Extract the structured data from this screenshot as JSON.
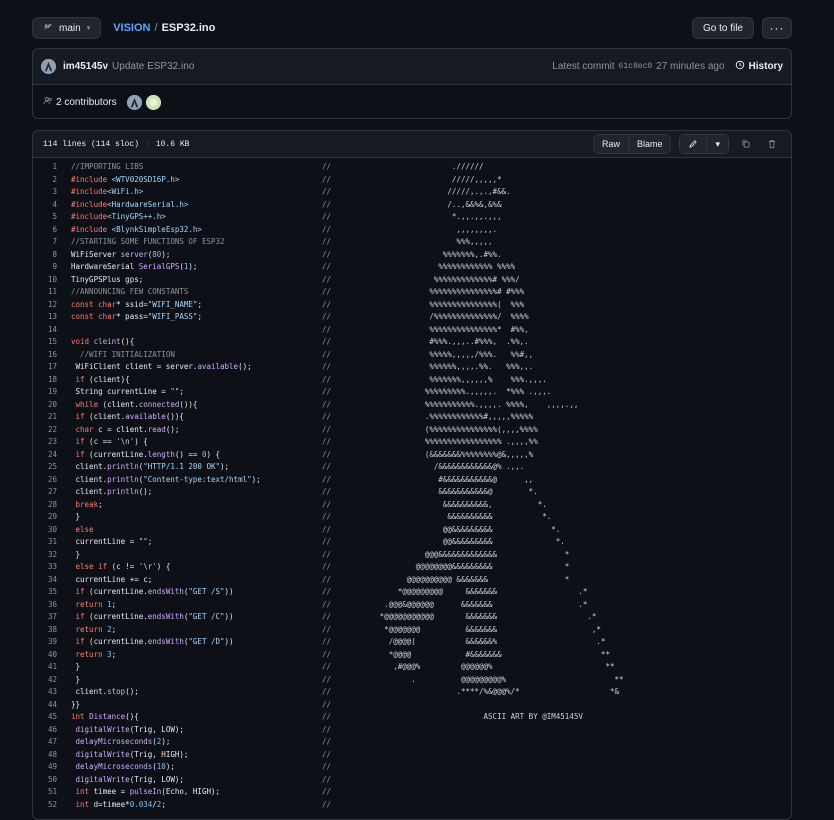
{
  "topbar": {
    "branch": "main",
    "repo": "VISION",
    "separator": "/",
    "file": "ESP32.ino",
    "goto_file": "Go to file",
    "more": "···"
  },
  "commit": {
    "author": "im45145v",
    "message": "Update ESP32.ino",
    "latest_label": "Latest commit",
    "hash": "61c8ec0",
    "time": "27 minutes ago",
    "history": "History",
    "contributors": "2 contributors"
  },
  "file_header": {
    "lines": "114 lines (114 sloc)",
    "size": "10.6 KB",
    "raw": "Raw",
    "blame": "Blame"
  },
  "code_lines": [
    {
      "n": "1",
      "code": "//IMPORTING LIBS",
      "art": "                           .//////"
    },
    {
      "n": "2",
      "code": "#include <WTV020SD16P.h>",
      "art": "                           /////,,,,,*"
    },
    {
      "n": "3",
      "code": "#include<WiFi.h>",
      "art": "                          /////,.,.,#&&."
    },
    {
      "n": "4",
      "code": "#include<HardwareSerial.h>",
      "art": "                          /..,&&%&,&%&"
    },
    {
      "n": "5",
      "code": "#include<TinyGPS++.h>",
      "art": "                           *.,,.,,.,,,"
    },
    {
      "n": "6",
      "code": "#include <BlynkSimpleEsp32.h>",
      "art": "                            ,,,,,,,,."
    },
    {
      "n": "7",
      "code": "//STARTING SOME FUNCTIONS OF ESP32",
      "art": "                            %%%,,,,,"
    },
    {
      "n": "8",
      "code": "WiFiServer server(80);",
      "art": "                         %%%%%%%,.#%%."
    },
    {
      "n": "9",
      "code": "HardwareSerial SerialGPS(1);",
      "art": "                        %%%%%%%%%%%% %%%%"
    },
    {
      "n": "10",
      "code": "TinyGPSPlus gps;",
      "art": "                       %%%%%%%%%%%%%# %%%/"
    },
    {
      "n": "11",
      "code": "//ANNOUNCING FEW CONSTANTS",
      "art": "                      %%%%%%%%%%%%%%%# #%%%"
    },
    {
      "n": "12",
      "code": "const char* ssid=\"WIFI_NAME\";",
      "art": "                      %%%%%%%%%%%%%%%(  %%%"
    },
    {
      "n": "13",
      "code": "const char* pass=\"WIFI_PASS\";",
      "art": "                      /%%%%%%%%%%%%%%/  %%%%"
    },
    {
      "n": "14",
      "code": "",
      "art": "                      %%%%%%%%%%%%%%%*  #%%,"
    },
    {
      "n": "15",
      "code": "void cleint(){",
      "art": "                      #%%%.,,,..#%%%,  .%%,."
    },
    {
      "n": "16",
      "code": "  //WIFI INITIALIZATION",
      "art": "                      %%%%%,,,,,/%%%.   %%#,,"
    },
    {
      "n": "17",
      "code": " WiFiClient client = server.available();",
      "art": "                      %%%%%%,,,,.%%.   %%%,,."
    },
    {
      "n": "18",
      "code": " if (client){",
      "art": "                      %%%%%%%,,,,,,%    %%%.,,,."
    },
    {
      "n": "19",
      "code": " String currentLine = \"\";",
      "art": "                     %%%%%%%%%.,,,,,.  *%%% .,,,."
    },
    {
      "n": "20",
      "code": " while (client.connected()){",
      "art": "                     %%%%%%%%%%%.,,,,. %%%%,    ,,,,.,,"
    },
    {
      "n": "21",
      "code": " if (client.available()){",
      "art": "                     .%%%%%%%%%%%%#,,,,,%%%%%"
    },
    {
      "n": "22",
      "code": " char c = client.read();",
      "art": "                     (%%%%%%%%%%%%%%%(,,,,%%%%"
    },
    {
      "n": "23",
      "code": " if (c == '\\n') {",
      "art": "                     %%%%%%%%%%%%%%%%% .,,,,%%"
    },
    {
      "n": "24",
      "code": " if (currentLine.length() == 0) {",
      "art": "                     (&&&&&&&%%%%%%%%@&,,,,,%"
    },
    {
      "n": "25",
      "code": " client.println(\"HTTP/1.1 200 OK\");",
      "art": "                       /&&&&&&&&&&&&@% .,,."
    },
    {
      "n": "26",
      "code": " client.println(\"Content-type:text/html\");",
      "art": "                        #&&&&&&&&&&&@      ,,"
    },
    {
      "n": "27",
      "code": " client.println();",
      "art": "                        &&&&&&&&&&&@        *."
    },
    {
      "n": "28",
      "code": " break;",
      "art": "                         &&&&&&&&&&,          *."
    },
    {
      "n": "29",
      "code": " }",
      "art": "                          &&&&&&&&&&           *."
    },
    {
      "n": "30",
      "code": " else",
      "art": "                         @@&&&&&&&&&             *."
    },
    {
      "n": "31",
      "code": " currentLine = \"\";",
      "art": "                         @@&&&&&&&&&              *."
    },
    {
      "n": "32",
      "code": " }",
      "art": "                     @@@&&&&&&&&&&&&&               *"
    },
    {
      "n": "33",
      "code": " else if (c != '\\r') {",
      "art": "                   @@@@@@@@&&&&&&&&&                *"
    },
    {
      "n": "34",
      "code": " currentLine += c;",
      "art": "                 @@@@@@@@@@ &&&&&&&                 *"
    },
    {
      "n": "35",
      "code": " if (currentLine.endsWith(\"GET /S\"))",
      "art": "               *@@@@@@@@@     &&&&&&&                  .*"
    },
    {
      "n": "36",
      "code": " return 1;",
      "art": "            .@@@&@@@@@@      &&&&&&&                   .*"
    },
    {
      "n": "37",
      "code": " if (currentLine.endsWith(\"GET /C\"))",
      "art": "           *@@@@@@@@@@@       &&&&&&&                    .*"
    },
    {
      "n": "38",
      "code": " return 2;",
      "art": "            *@@@@@@@          &&&&&&&                     ,*"
    },
    {
      "n": "39",
      "code": " if (currentLine.endsWith(\"GET /D\"))",
      "art": "             /@@@@(           &&&&&&%                      .*"
    },
    {
      "n": "40",
      "code": " return 3;",
      "art": "             *@@@@            #&&&&&&&                      **"
    },
    {
      "n": "41",
      "code": " }",
      "art": "              ,#@@@%         @@@@@@%                         **"
    },
    {
      "n": "42",
      "code": " }",
      "art": "                  .          @@@@@@@@@%                        **"
    },
    {
      "n": "43",
      "code": " client.stop();",
      "art": "                            .****/%&@@@%/*                    *&"
    },
    {
      "n": "44",
      "code": "}}",
      "art": ""
    },
    {
      "n": "45",
      "code": "int Distance(){",
      "art": "                                  ASCII ART BY @IM45145V"
    },
    {
      "n": "46",
      "code": " digitalWrite(Trig, LOW);",
      "art": ""
    },
    {
      "n": "47",
      "code": " delayMicroseconds(2);",
      "art": ""
    },
    {
      "n": "48",
      "code": " digitalWrite(Trig, HIGH);",
      "art": ""
    },
    {
      "n": "49",
      "code": " delayMicroseconds(10);",
      "art": ""
    },
    {
      "n": "50",
      "code": " digitalWrite(Trig, LOW);",
      "art": ""
    },
    {
      "n": "51",
      "code": " int timee = pulseIn(Echo, HIGH);",
      "art": ""
    },
    {
      "n": "52",
      "code": " int d=timee*0.034/2;",
      "art": ""
    }
  ]
}
